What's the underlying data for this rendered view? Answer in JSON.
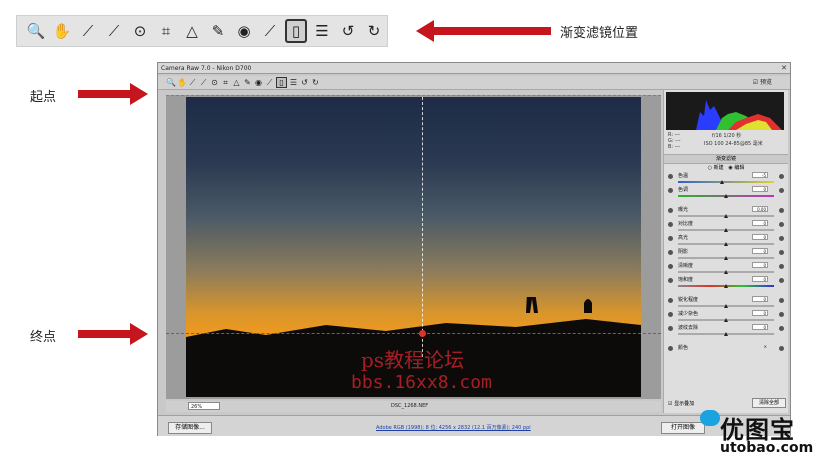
{
  "toolbar_strip": {
    "tools": [
      {
        "icon": "zoom-icon",
        "glyph": "🔍"
      },
      {
        "icon": "hand-icon",
        "glyph": "✋"
      },
      {
        "icon": "white-balance-eyedropper-icon",
        "glyph": "⟋"
      },
      {
        "icon": "color-sampler-icon",
        "glyph": "⟋"
      },
      {
        "icon": "target-adjustment-icon",
        "glyph": "⊙"
      },
      {
        "icon": "crop-icon",
        "glyph": "⌗"
      },
      {
        "icon": "straighten-icon",
        "glyph": "△"
      },
      {
        "icon": "spot-removal-icon",
        "glyph": "✎"
      },
      {
        "icon": "red-eye-icon",
        "glyph": "◉"
      },
      {
        "icon": "adjustment-brush-icon",
        "glyph": "⟋"
      },
      {
        "icon": "graduated-filter-icon",
        "glyph": "▯"
      },
      {
        "icon": "preferences-list-icon",
        "glyph": "☰"
      },
      {
        "icon": "rotate-left-icon",
        "glyph": "↺"
      },
      {
        "icon": "rotate-right-icon",
        "glyph": "↻"
      }
    ],
    "selected_index": 10
  },
  "annotations": {
    "filter_position": "渐变滤镜位置",
    "start_point": "起点",
    "end_point": "终点"
  },
  "window": {
    "title": "Camera Raw 7.0 - Nikon D700",
    "preview_label": "预览",
    "zoom": "26%",
    "filename": "DSC_1268.NEF",
    "save_button": "存储图像...",
    "workflow_link": "Adobe RGB (1998); 8 位; 4256 x 2832 (12.1 百万像素); 240 ppi",
    "open_button": "打开图像"
  },
  "panel": {
    "readout": {
      "r": "R: ---",
      "g": "G: ---",
      "b": "B: ---",
      "exif1": "f/16   1/20 秒",
      "exif2": "ISO 100   24-85@85 毫米"
    },
    "title": "渐变滤镜",
    "radio_new": "新建",
    "radio_edit": "编辑",
    "sliders": [
      {
        "name": "色温",
        "value": "-5",
        "kind": "temp",
        "pos": 0.46
      },
      {
        "name": "色调",
        "value": "0",
        "kind": "tint",
        "pos": 0.5
      },
      {
        "name": "曝光",
        "value": "0.00",
        "kind": "plain",
        "pos": 0.5
      },
      {
        "name": "对比度",
        "value": "0",
        "kind": "plain",
        "pos": 0.5
      },
      {
        "name": "高光",
        "value": "0",
        "kind": "plain",
        "pos": 0.5
      },
      {
        "name": "阴影",
        "value": "0",
        "kind": "plain",
        "pos": 0.5
      },
      {
        "name": "清晰度",
        "value": "0",
        "kind": "plain",
        "pos": 0.5
      },
      {
        "name": "饱和度",
        "value": "0",
        "kind": "sat",
        "pos": 0.5
      },
      {
        "name": "锐化程度",
        "value": "0",
        "kind": "plain",
        "pos": 0.5
      },
      {
        "name": "减少杂色",
        "value": "0",
        "kind": "plain",
        "pos": 0.5
      },
      {
        "name": "波纹去除",
        "value": "0",
        "kind": "plain",
        "pos": 0.5
      },
      {
        "name": "颜色",
        "value": "",
        "kind": "none",
        "pos": 0
      }
    ],
    "show_mask": "显示叠加",
    "clear_all": "清除全部"
  },
  "watermark": {
    "line1": "ps教程论坛",
    "line2": "bbs.16xx8.com"
  },
  "logo": {
    "title": "优图宝",
    "url": "utobao.com"
  },
  "colors": {
    "arrow": "#c4161c",
    "guide_green": "#2fb53c",
    "guide_red": "#e03030"
  }
}
